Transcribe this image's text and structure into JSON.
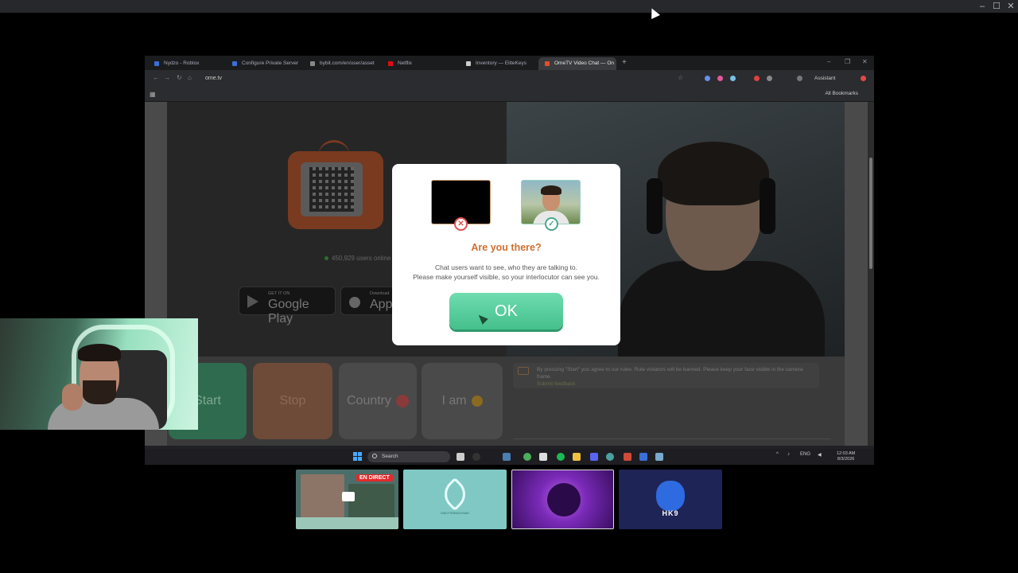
{
  "host_window": {
    "minimize": "–",
    "maximize": "☐",
    "close": "✕"
  },
  "browser": {
    "tabs": [
      {
        "label": "Nydzo - Roblox",
        "favicon_color": "#3a6fd8"
      },
      {
        "label": "Configure Private Server",
        "favicon_color": "#3a6fd8"
      },
      {
        "label": "bybit.com/en/user/asset",
        "favicon_color": "#888888"
      },
      {
        "label": "Netflix",
        "favicon_color": "#e50914"
      },
      {
        "label": "Inventory — EliteKeys",
        "favicon_color": "#cccccc"
      },
      {
        "label": "OmeTV Video Chat — On",
        "favicon_color": "#e0502a"
      }
    ],
    "new_tab": "+",
    "url": "ome.tv",
    "assistant_label": "Assistant",
    "all_bookmarks": "All Bookmarks"
  },
  "page": {
    "users_online": "450,929 users online",
    "store_google": {
      "small": "GET IT ON",
      "big": "Google Play"
    },
    "store_apple": {
      "small": "Download",
      "big": "App"
    },
    "buttons": {
      "start": "Start",
      "stop": "Stop",
      "country": "Country",
      "i_am": "I am"
    },
    "chat_notice": {
      "line1": "By pressing \"Start\" you agree to our rules. Rule violators will be banned. Please keep your face visible in the camera frame.",
      "line2": "Submit feedback"
    }
  },
  "modal": {
    "title": "Are you there?",
    "text_line1": "Chat users want to see, who they are talking to.",
    "text_line2": "Please make yourself visible, so your interlocutor can see you.",
    "ok_label": "OK",
    "x_mark": "✕",
    "check_mark": "✓"
  },
  "taskbar": {
    "search_placeholder": "Search",
    "lang": "ENG",
    "time": "12:03 AM",
    "date": "8/3/2026"
  },
  "scenes": [
    {
      "name": "live",
      "badge": "EN DIRECT"
    },
    {
      "name": "brand",
      "caption": "EMOTIPANDOSAM"
    },
    {
      "name": "purple"
    },
    {
      "name": "hk9",
      "caption": "HK9"
    }
  ],
  "colors": {
    "ok_button": "#45c08c",
    "modal_title": "#d07030",
    "live_badge": "#e12a2a"
  }
}
